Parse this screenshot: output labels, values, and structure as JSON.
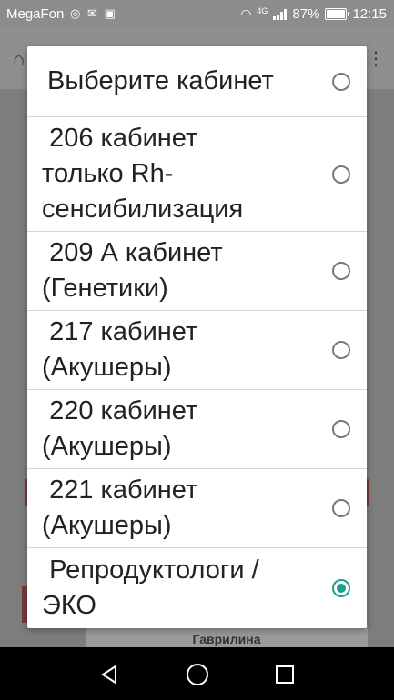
{
  "status_bar": {
    "carrier": "MegaFon",
    "network": "4G",
    "battery_percent": "87%",
    "time": "12:15",
    "battery_level": 0.87
  },
  "background": {
    "footer_name": "Гаврилина"
  },
  "dialog": {
    "options": [
      {
        "label": "Выберите кабинет",
        "checked": false
      },
      {
        "label": " 206 кабинет\nтолько Rh-\nсенсибилизация",
        "checked": false
      },
      {
        "label": " 209 А кабинет\n(Генетики)",
        "checked": false
      },
      {
        "label": " 217 кабинет\n(Акушеры)",
        "checked": false
      },
      {
        "label": " 220 кабинет\n(Акушеры)",
        "checked": false
      },
      {
        "label": " 221 кабинет\n(Акушеры)",
        "checked": false
      },
      {
        "label": " Репродуктологи /\nЭКО",
        "checked": true
      }
    ]
  },
  "colors": {
    "accent": "#1aa08a",
    "dialog_bg": "#ffffff",
    "scrim": "#8a8a8a"
  }
}
